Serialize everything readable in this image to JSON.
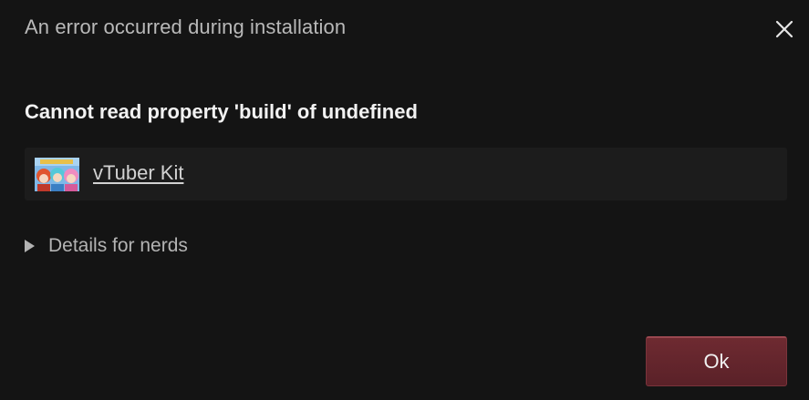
{
  "dialog": {
    "title": "An error occurred during installation",
    "error_message": "Cannot read property 'build' of undefined",
    "game": {
      "name": "vTuber Kit",
      "thumbnail_icon": "game-thumbnail"
    },
    "details_label": "Details for nerds",
    "ok_label": "Ok"
  },
  "colors": {
    "background": "#141414",
    "panel": "#1c1c1c",
    "accent": "#6e2a31"
  }
}
